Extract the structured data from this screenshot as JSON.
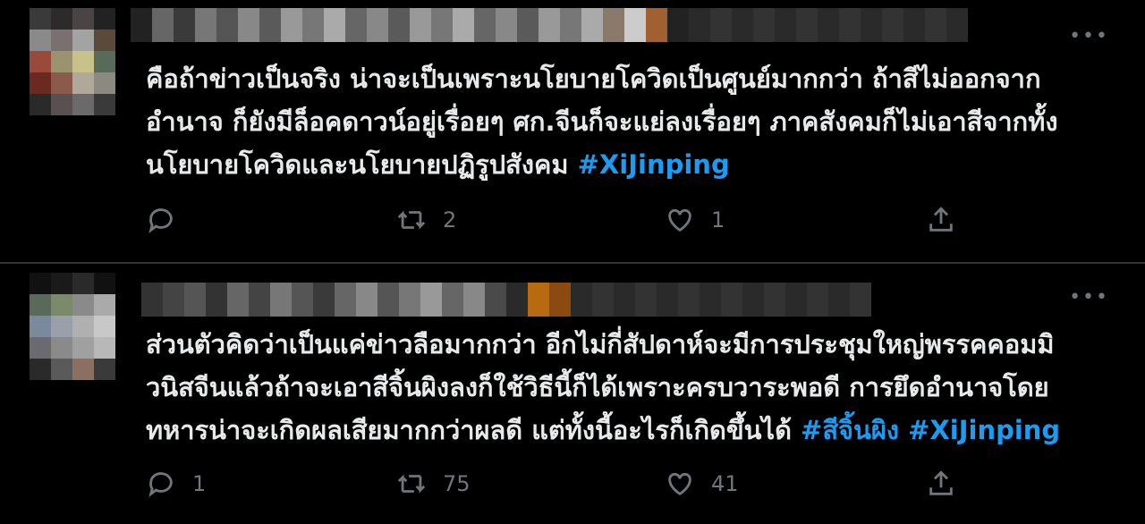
{
  "tweets": [
    {
      "text": "คือถ้าข่าวเป็นจริง น่าจะเป็นเพราะนโยบายโควิดเป็นศูนย์มากกว่า ถ้าสีไม่ออกจาก\nอำนาจ ก็ยังมีล็อคดาวน์อยู่เรื่อยๆ ศก.จีนก็จะแย่ลงเรื่อยๆ ภาคสังคมก็ไม่เอาสีจากทั้ง\nนโยบายโควิดและนโยบายปฏิรูปสังคม ",
      "hashtags": [
        "#XiJinping"
      ],
      "reply_count": "",
      "retweet_count": "2",
      "like_count": "1"
    },
    {
      "text": "ส่วนตัวคิดว่าเป็นแค่ข่าวลือมากกว่า อีกไม่กี่สัปดาห์จะมีการประชุมใหญ่พรรคคอมมิ\nวนิสจีนแล้วถ้าจะเอาสีจิ้นผิงลงก็ใช้วิธีนี้ก็ได้เพราะครบวาระพอดี การยึดอำนาจโดย\nทหารน่าจะเกิดผลเสียมากกว่าผลดี แต่ทั้งนี้อะไรก็เกิดขึ้นได้ ",
      "hashtags": [
        "#สีจิ้นผิง",
        "#XiJinping"
      ],
      "reply_count": "1",
      "retweet_count": "75",
      "like_count": "41"
    }
  ],
  "icons": {
    "reply": "reply-icon",
    "retweet": "retweet-icon",
    "like": "heart-icon",
    "share": "share-icon",
    "more": "more-icon"
  },
  "more_glyph": "•••",
  "colors": {
    "background": "#000000",
    "text": "#e7e9ea",
    "muted": "#71767b",
    "hashtag": "#1d9bf0",
    "divider": "#2f3336"
  }
}
